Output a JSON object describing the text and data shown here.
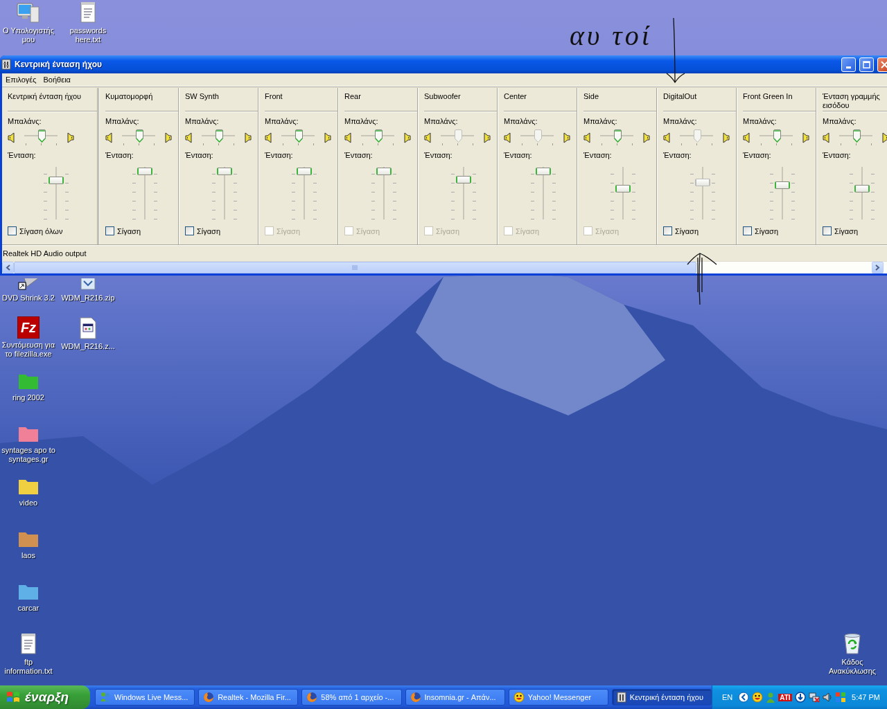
{
  "desktop": {
    "icons": [
      {
        "label": "Ο Υπολογιστής μου",
        "kind": "computer"
      },
      {
        "label": "passwords here.txt",
        "kind": "text"
      },
      {
        "label": "DVD Shrink 3.2",
        "kind": "disc"
      },
      {
        "label": "WDM_R216.zip",
        "kind": "zip"
      },
      {
        "label": "Συντόμευση για το filezilla.exe",
        "kind": "filezilla",
        "icon_text": "Fz"
      },
      {
        "label": "WDM_R216.z...",
        "kind": "app-file"
      },
      {
        "label": "ring 2002",
        "kind": "folder",
        "color": "#33bb33"
      },
      {
        "label": "syntages apo to syntages.gr",
        "kind": "folder",
        "color": "#f08098"
      },
      {
        "label": "video",
        "kind": "folder",
        "color": "#f0d040"
      },
      {
        "label": "laos",
        "kind": "folder",
        "color": "#d09050"
      },
      {
        "label": "carcar",
        "kind": "folder",
        "color": "#60b0e8"
      },
      {
        "label": "ftp information.txt",
        "kind": "text"
      },
      {
        "label": "Κάδος Ανακύκλωσης",
        "kind": "recycle"
      }
    ]
  },
  "annotation": {
    "text": "αυ τοί"
  },
  "window": {
    "title": "Κεντρική ένταση ήχου",
    "menu": [
      "Επιλογές",
      "Βοήθεια"
    ],
    "channels": [
      {
        "name": "Κεντρική ένταση ήχου",
        "balance": {
          "label": "Μπαλάνς:",
          "level": 0.5,
          "disabled": false
        },
        "volume": {
          "label": "Ένταση:",
          "level": 0.77,
          "disabled": false
        },
        "mute": {
          "label": "Σίγαση όλων",
          "checked": false,
          "disabled": false
        }
      },
      {
        "name": "Κυματομορφή",
        "balance": {
          "label": "Μπαλάνς:",
          "level": 0.5,
          "disabled": false
        },
        "volume": {
          "label": "Ένταση:",
          "level": 0.95,
          "disabled": false
        },
        "mute": {
          "label": "Σίγαση",
          "checked": false,
          "disabled": false
        }
      },
      {
        "name": "SW Synth",
        "balance": {
          "label": "Μπαλάνς:",
          "level": 0.5,
          "disabled": false
        },
        "volume": {
          "label": "Ένταση:",
          "level": 0.95,
          "disabled": false
        },
        "mute": {
          "label": "Σίγαση",
          "checked": false,
          "disabled": false
        }
      },
      {
        "name": "Front",
        "balance": {
          "label": "Μπαλάνς:",
          "level": 0.5,
          "disabled": false
        },
        "volume": {
          "label": "Ένταση:",
          "level": 0.95,
          "disabled": false
        },
        "mute": {
          "label": "Σίγαση",
          "checked": false,
          "disabled": true
        }
      },
      {
        "name": "Rear",
        "balance": {
          "label": "Μπαλάνς:",
          "level": 0.5,
          "disabled": false
        },
        "volume": {
          "label": "Ένταση:",
          "level": 0.95,
          "disabled": false
        },
        "mute": {
          "label": "Σίγαση",
          "checked": false,
          "disabled": true
        }
      },
      {
        "name": "Subwoofer",
        "balance": {
          "label": "Μπαλάνς:",
          "level": 0.5,
          "disabled": true
        },
        "volume": {
          "label": "Ένταση:",
          "level": 0.78,
          "disabled": false
        },
        "mute": {
          "label": "Σίγαση",
          "checked": false,
          "disabled": true
        }
      },
      {
        "name": "Center",
        "balance": {
          "label": "Μπαλάνς:",
          "level": 0.5,
          "disabled": true
        },
        "volume": {
          "label": "Ένταση:",
          "level": 0.95,
          "disabled": false
        },
        "mute": {
          "label": "Σίγαση",
          "checked": false,
          "disabled": true
        }
      },
      {
        "name": "Side",
        "balance": {
          "label": "Μπαλάνς:",
          "level": 0.5,
          "disabled": false
        },
        "volume": {
          "label": "Ένταση:",
          "level": 0.6,
          "disabled": false
        },
        "mute": {
          "label": "Σίγαση",
          "checked": false,
          "disabled": true
        }
      },
      {
        "name": "DigitalOut",
        "balance": {
          "label": "Μπαλάνς:",
          "level": 0.5,
          "disabled": true
        },
        "volume": {
          "label": "Ένταση:",
          "level": 0.73,
          "disabled": true
        },
        "mute": {
          "label": "Σίγαση",
          "checked": false,
          "disabled": false
        }
      },
      {
        "name": "Front Green In",
        "balance": {
          "label": "Μπαλάνς:",
          "level": 0.5,
          "disabled": false
        },
        "volume": {
          "label": "Ένταση:",
          "level": 0.67,
          "disabled": false
        },
        "mute": {
          "label": "Σίγαση",
          "checked": false,
          "disabled": false
        }
      },
      {
        "name": "Ένταση γραμμής εισόδου",
        "balance": {
          "label": "Μπαλάνς:",
          "level": 0.5,
          "disabled": false
        },
        "volume": {
          "label": "Ένταση:",
          "level": 0.59,
          "disabled": false
        },
        "mute": {
          "label": "Σίγαση",
          "checked": false,
          "disabled": false
        }
      }
    ],
    "status": "Realtek HD Audio output"
  },
  "taskbar": {
    "start": "έναρξη",
    "tasks": [
      {
        "label": "Windows Live Mess...",
        "kind": "messenger",
        "selected": false
      },
      {
        "label": "Realtek - Mozilla Fir...",
        "kind": "browser",
        "selected": false
      },
      {
        "label": "58% από 1 αρχείο -...",
        "kind": "browser",
        "selected": false
      },
      {
        "label": "Insomnia.gr - Απάν...",
        "kind": "browser",
        "selected": false
      },
      {
        "label": "Yahoo! Messenger",
        "kind": "chat",
        "selected": false
      },
      {
        "label": "Κεντρική ένταση ήχου",
        "kind": "mixer",
        "selected": true
      }
    ],
    "tray": {
      "language": "EN",
      "ati": "ATI",
      "clock": "5:47 PM"
    }
  }
}
